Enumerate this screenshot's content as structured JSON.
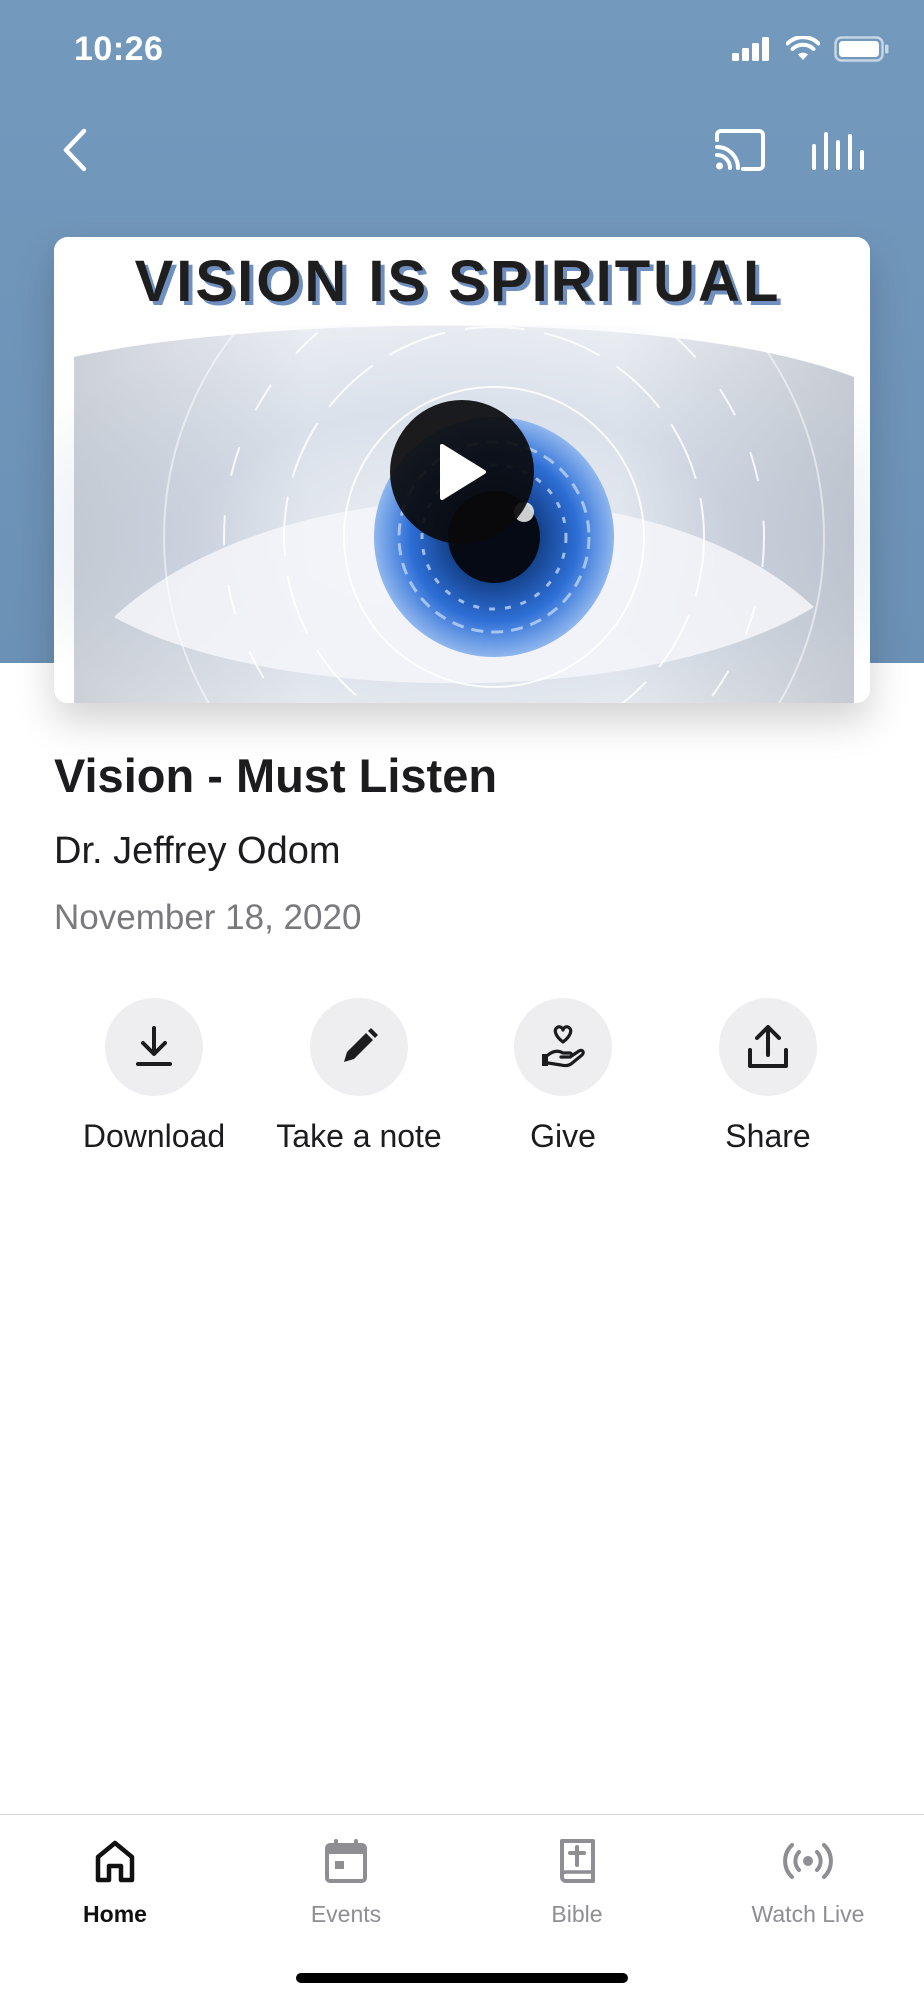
{
  "status_bar": {
    "time": "10:26"
  },
  "nav": {
    "back_icon": "chevron-left-icon",
    "cast_icon": "cast-icon",
    "equalizer_icon": "equalizer-icon"
  },
  "artwork": {
    "banner_text": "VISION IS SPIRITUAL",
    "play_icon": "play-icon"
  },
  "sermon": {
    "title": "Vision - Must Listen",
    "speaker": "Dr. Jeffrey Odom",
    "date": "November 18, 2020"
  },
  "actions": [
    {
      "label": "Download",
      "icon": "download-icon"
    },
    {
      "label": "Take a note",
      "icon": "pencil-icon"
    },
    {
      "label": "Give",
      "icon": "hand-heart-icon"
    },
    {
      "label": "Share",
      "icon": "share-icon"
    }
  ],
  "tabs": [
    {
      "label": "Home",
      "icon": "home-icon",
      "active": true
    },
    {
      "label": "Events",
      "icon": "calendar-icon",
      "active": false
    },
    {
      "label": "Bible",
      "icon": "bible-icon",
      "active": false
    },
    {
      "label": "Watch Live",
      "icon": "broadcast-icon",
      "active": false
    }
  ],
  "colors": {
    "header": "#7399bd",
    "action_circle": "#eeeef0",
    "tab_inactive": "#8e8e93",
    "tab_active": "#111111",
    "iris": "#2e6fd6"
  }
}
